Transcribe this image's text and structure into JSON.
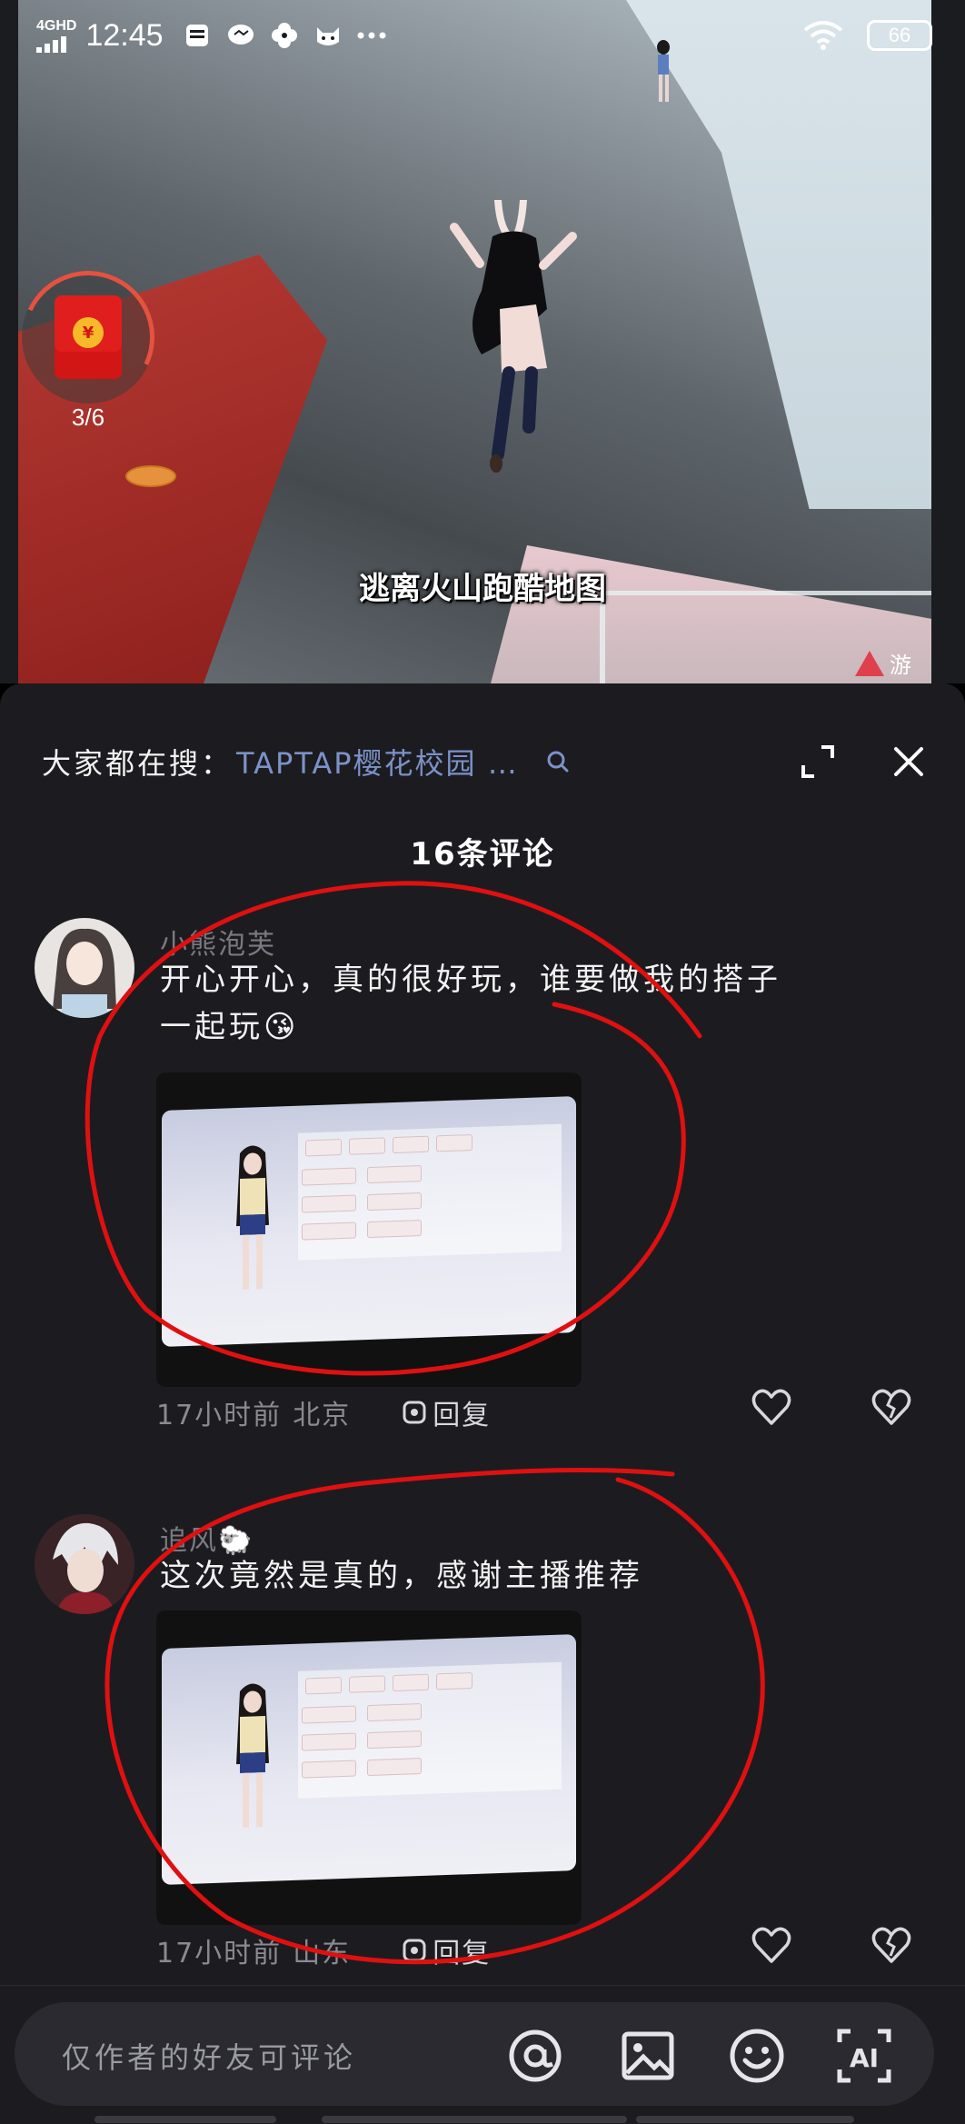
{
  "status_bar": {
    "network": "4GHD",
    "time": "12:45",
    "battery": "66",
    "app_icons": [
      "sim-card-icon",
      "chat-bubble-icon",
      "pinwheel-icon",
      "cat-face-icon",
      "more-dots-icon"
    ]
  },
  "video": {
    "subtitle": "逃离火山跑酷地图",
    "warning_text": "游",
    "red_packet": {
      "progress": "3/6",
      "symbol": "¥"
    }
  },
  "sheet": {
    "search_prefix": "大家都在搜：",
    "search_term": "TAPTAP樱花校园 …",
    "comment_count_title": "16条评论"
  },
  "comments": [
    {
      "username": "小熊泡芙",
      "text_line1": "开心开心，真的很好玩，谁要做我的搭子",
      "text_line2": "一起玩😘",
      "time": "17小时前",
      "location": "北京",
      "reply_label": "回复"
    },
    {
      "username": "追风🐑",
      "text_line1": "这次竟然是真的，感谢主播推荐",
      "text_line2": "",
      "time": "17小时前",
      "location": "山东",
      "reply_label": "回复"
    }
  ],
  "bottom_bar": {
    "input_placeholder": "仅作者的好友可评论",
    "icons": [
      "at-icon",
      "image-icon",
      "emoji-icon",
      "ai-icon"
    ]
  },
  "colors": {
    "sheet_bg": "#1c1c20",
    "search_term": "#7c92c8",
    "marker_red": "#e01010"
  }
}
